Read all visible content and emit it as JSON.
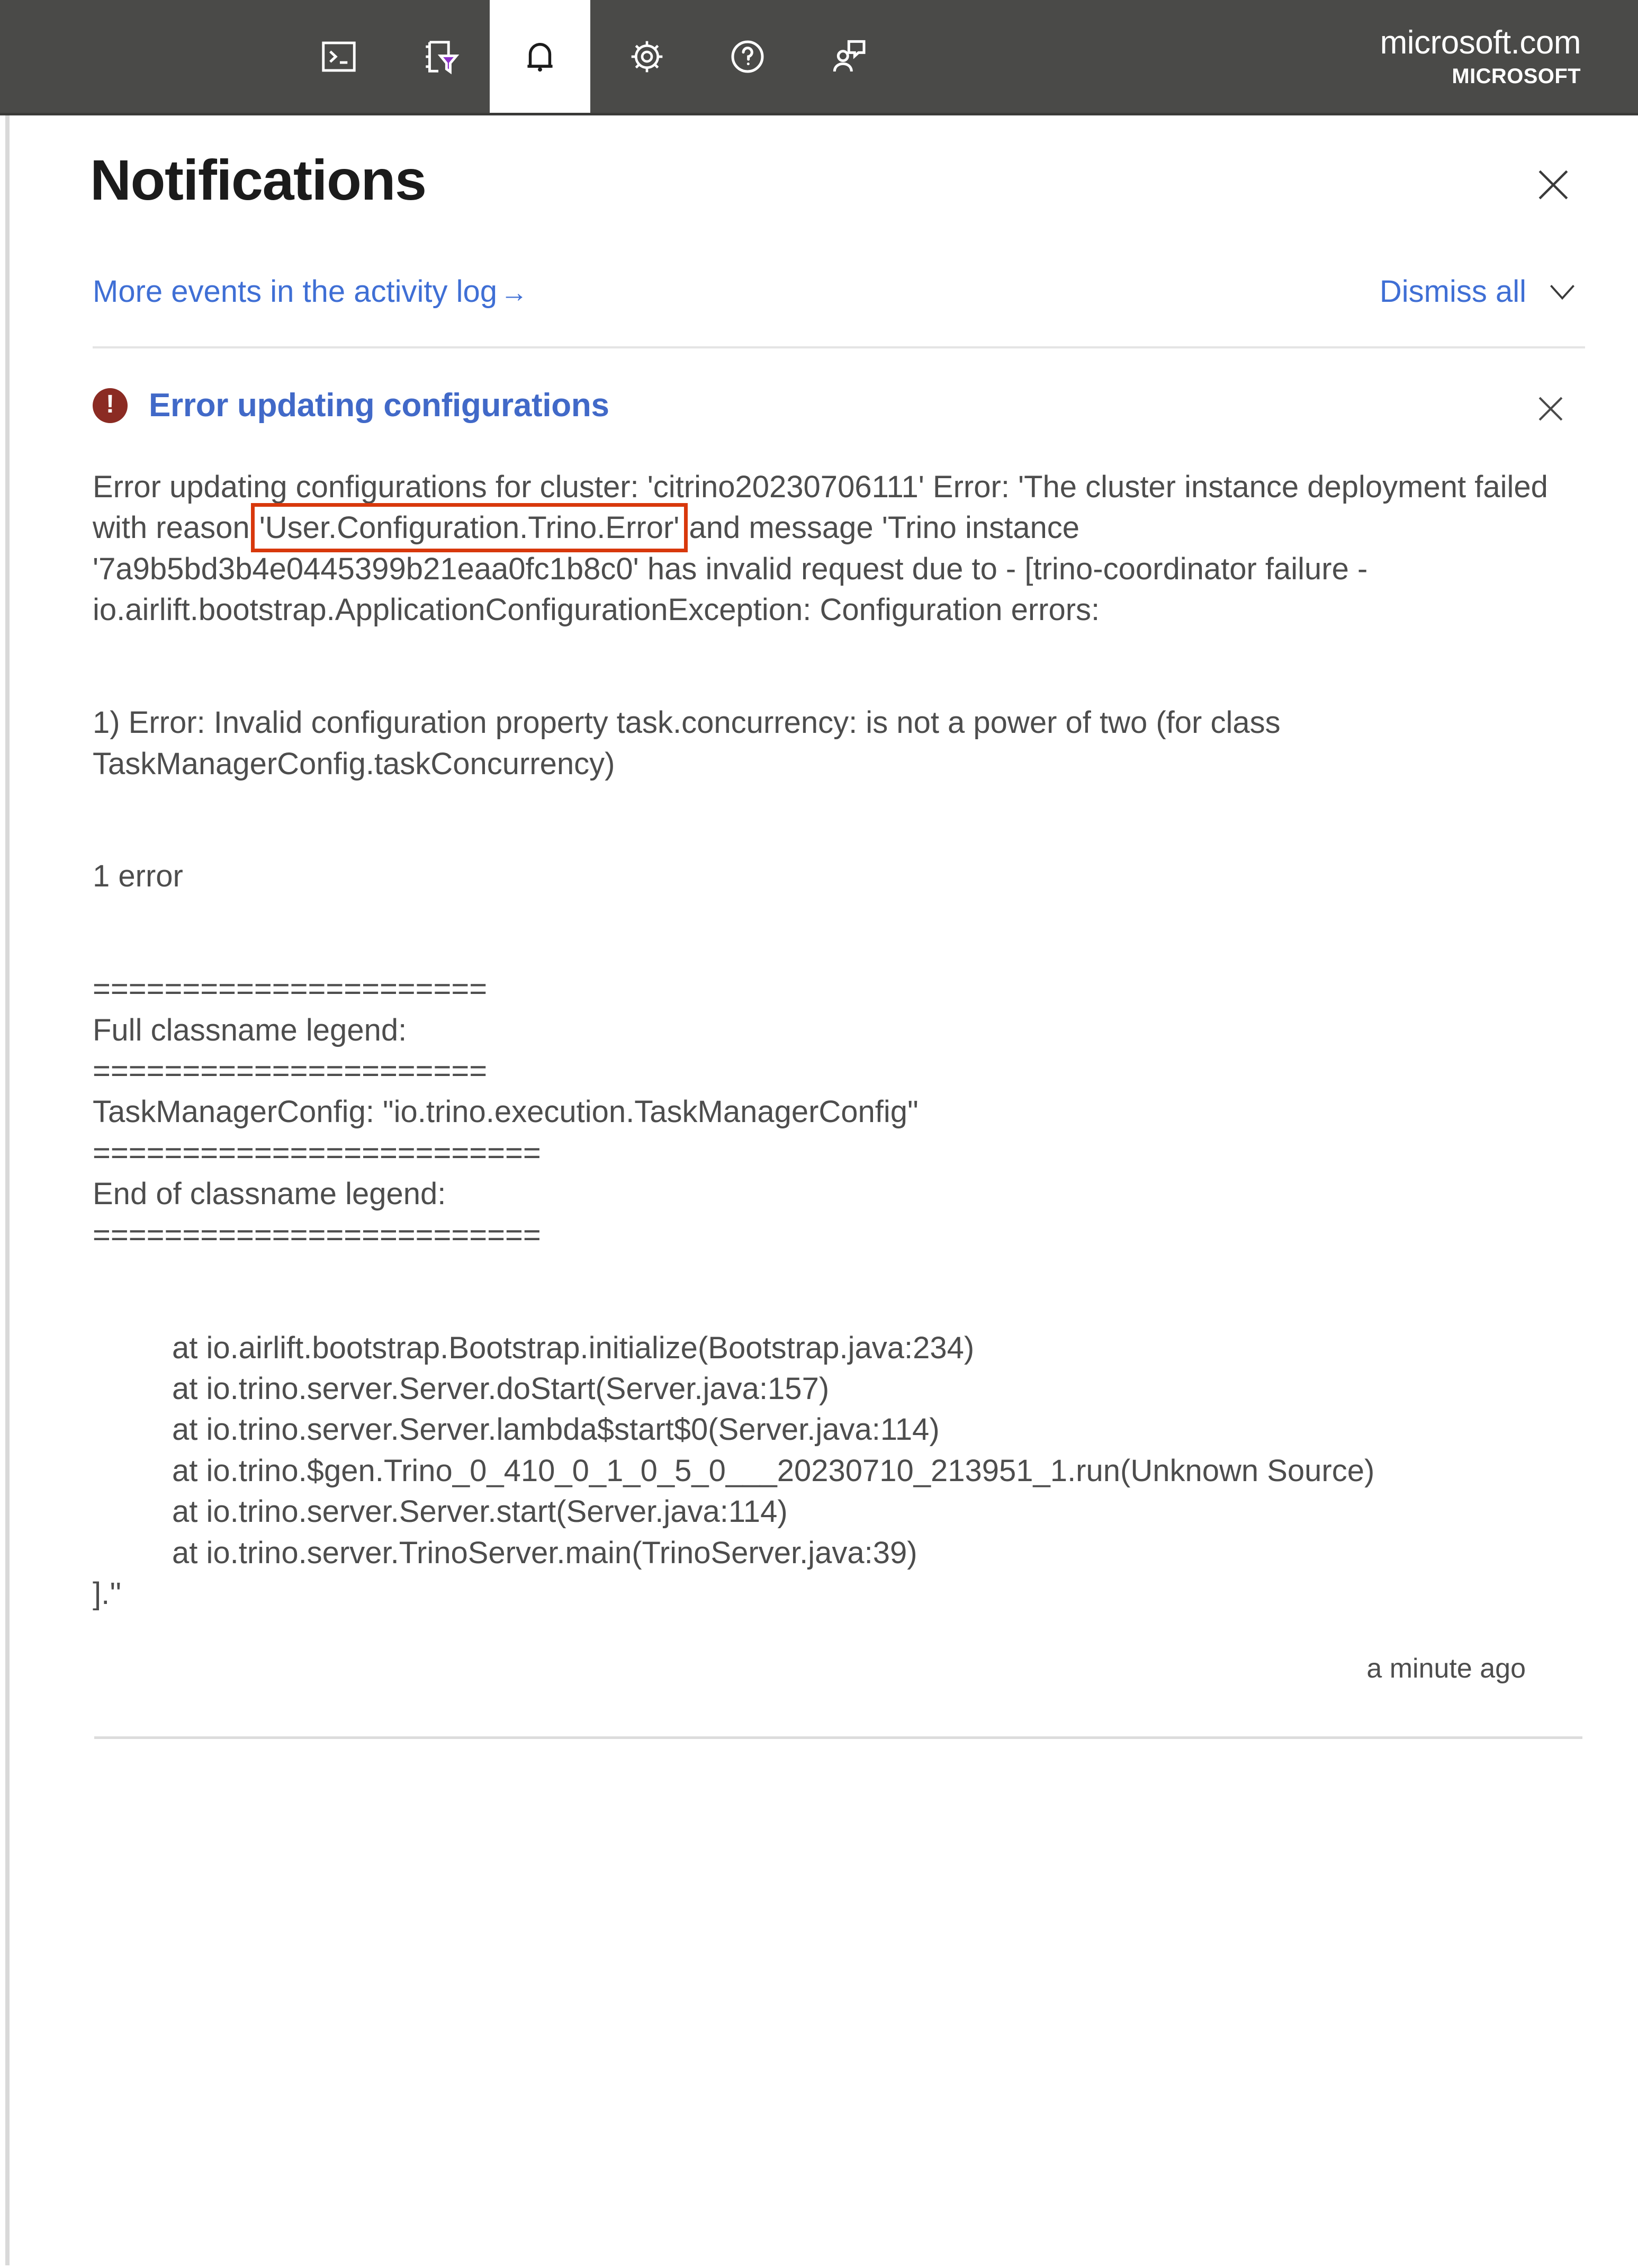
{
  "topbar": {
    "icons": [
      {
        "name": "cloud-shell-icon",
        "label": "Cloud Shell"
      },
      {
        "name": "directory-filter-icon",
        "label": "Directories + subscriptions"
      },
      {
        "name": "notifications-bell-icon",
        "label": "Notifications"
      },
      {
        "name": "settings-gear-icon",
        "label": "Settings"
      },
      {
        "name": "help-question-icon",
        "label": "Help"
      },
      {
        "name": "feedback-person-icon",
        "label": "Feedback"
      }
    ],
    "account": {
      "domain": "microsoft.com",
      "organization": "MICROSOFT"
    }
  },
  "panel": {
    "title": "Notifications",
    "close_label": "Close",
    "more_events_link": "More events in the activity log",
    "more_events_arrow": "→",
    "dismiss_all_label": "Dismiss all"
  },
  "notification": {
    "severity": "error",
    "badge_glyph": "!",
    "title": "Error updating configurations",
    "dismiss_label": "Dismiss",
    "timestamp": "a minute ago",
    "highlight_color": "#d8380c",
    "body": {
      "lead_before_highlight": "Error updating configurations for cluster: 'citrino20230706111' Error: 'The cluster instance deployment failed with reason ",
      "highlighted_text": "'User.Configuration.Trino.Error'",
      "lead_after_highlight": " and message 'Trino instance '7a9b5bd3b4e0445399b21eaa0fc1b8c0' has invalid request due to - [trino-coordinator failure - io.airlift.bootstrap.ApplicationConfigurationException: Configuration errors:",
      "error_item": "1) Error: Invalid configuration property task.concurrency: is not a power of two (for class TaskManagerConfig.taskConcurrency)",
      "error_count": "1 error",
      "legend_rule_top": "======================",
      "legend_heading": "Full classname legend:",
      "legend_rule_mid": "======================",
      "legend_entry": "TaskManagerConfig: \"io.trino.execution.TaskManagerConfig\"",
      "legend_rule_end_top": "=========================",
      "legend_end_heading": "End of classname legend:",
      "legend_rule_end_bottom": "=========================",
      "stack_trace": [
        "at io.airlift.bootstrap.Bootstrap.initialize(Bootstrap.java:234)",
        "at io.trino.server.Server.doStart(Server.java:157)",
        "at io.trino.server.Server.lambda$start$0(Server.java:114)",
        "at io.trino.$gen.Trino_0_410_0_1_0_5_0___20230710_213951_1.run(Unknown Source)",
        "at io.trino.server.Server.start(Server.java:114)",
        "at io.trino.server.TrinoServer.main(TrinoServer.java:39)"
      ],
      "closing": "].''"
    }
  },
  "colors": {
    "topbar_bg": "#4a4a48",
    "link_blue": "#3f6fd5",
    "title_blue": "#4169c8",
    "error_red": "#8b2b23",
    "highlight_orange": "#d8380c",
    "body_gray": "#4d4d4d"
  }
}
